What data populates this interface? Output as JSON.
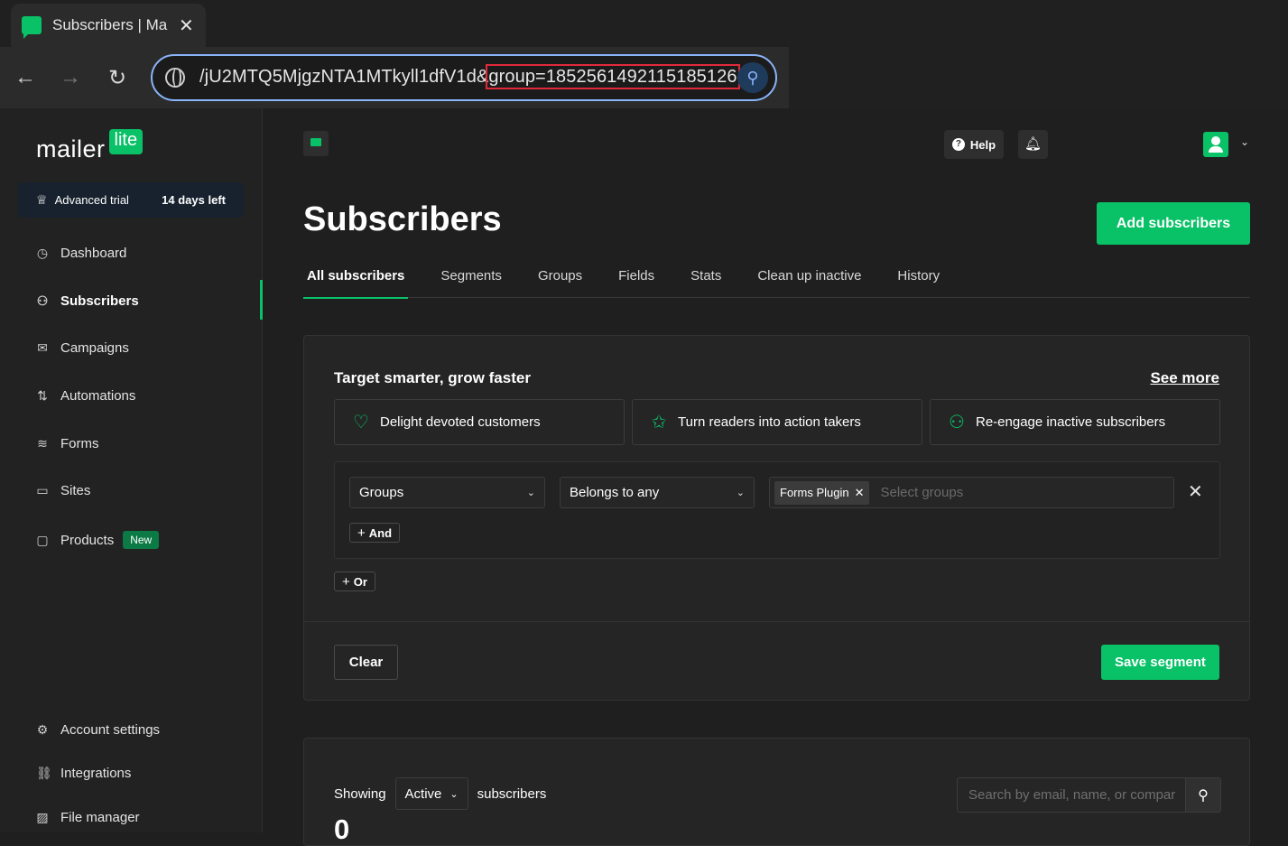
{
  "browser": {
    "tab_title": "Subscribers | Ma",
    "url_prefix": "/jU2MTQ5MjgzNTA1MTkyll1dfV1d&",
    "url_highlight": "group=185256149211518512​6",
    "url_highlight_clean": "group=1852561492115185126"
  },
  "sidebar": {
    "logo_text": "mailer",
    "logo_badge": "lite",
    "trial_label": "Advanced trial",
    "trial_days": "14 days left",
    "items": [
      {
        "label": "Dashboard",
        "icon": "clock-icon"
      },
      {
        "label": "Subscribers",
        "icon": "user-icon"
      },
      {
        "label": "Campaigns",
        "icon": "envelope-icon"
      },
      {
        "label": "Automations",
        "icon": "workflow-icon"
      },
      {
        "label": "Forms",
        "icon": "layers-icon"
      },
      {
        "label": "Sites",
        "icon": "browser-icon"
      },
      {
        "label": "Products",
        "icon": "bag-icon",
        "badge": "New"
      }
    ],
    "bottom_items": [
      {
        "label": "Account settings",
        "icon": "gear-icon"
      },
      {
        "label": "Integrations",
        "icon": "link-icon"
      },
      {
        "label": "File manager",
        "icon": "image-icon"
      }
    ]
  },
  "header": {
    "help_label": "Help"
  },
  "page": {
    "title": "Subscribers",
    "add_button": "Add subscribers",
    "tabs": [
      "All subscribers",
      "Segments",
      "Groups",
      "Fields",
      "Stats",
      "Clean up inactive",
      "History"
    ]
  },
  "segment_card": {
    "heading": "Target smarter, grow faster",
    "see_more": "See more",
    "suggestions": [
      "Delight devoted customers",
      "Turn readers into action takers",
      "Re-engage inactive subscribers"
    ],
    "filter_field": "Groups",
    "filter_operator": "Belongs to any",
    "chip": "Forms Plugin",
    "groups_placeholder": "Select groups",
    "and_label": "And",
    "or_label": "Or",
    "clear_label": "Clear",
    "save_label": "Save segment"
  },
  "list_card": {
    "showing_label": "Showing",
    "status_value": "Active",
    "subscribers_label": "subscribers",
    "count": "0",
    "search_placeholder": "Search by email, name, or compar"
  },
  "colors": {
    "accent": "#09c167",
    "background": "#1f1f1f",
    "url_highlight_border": "#e02a3a"
  }
}
